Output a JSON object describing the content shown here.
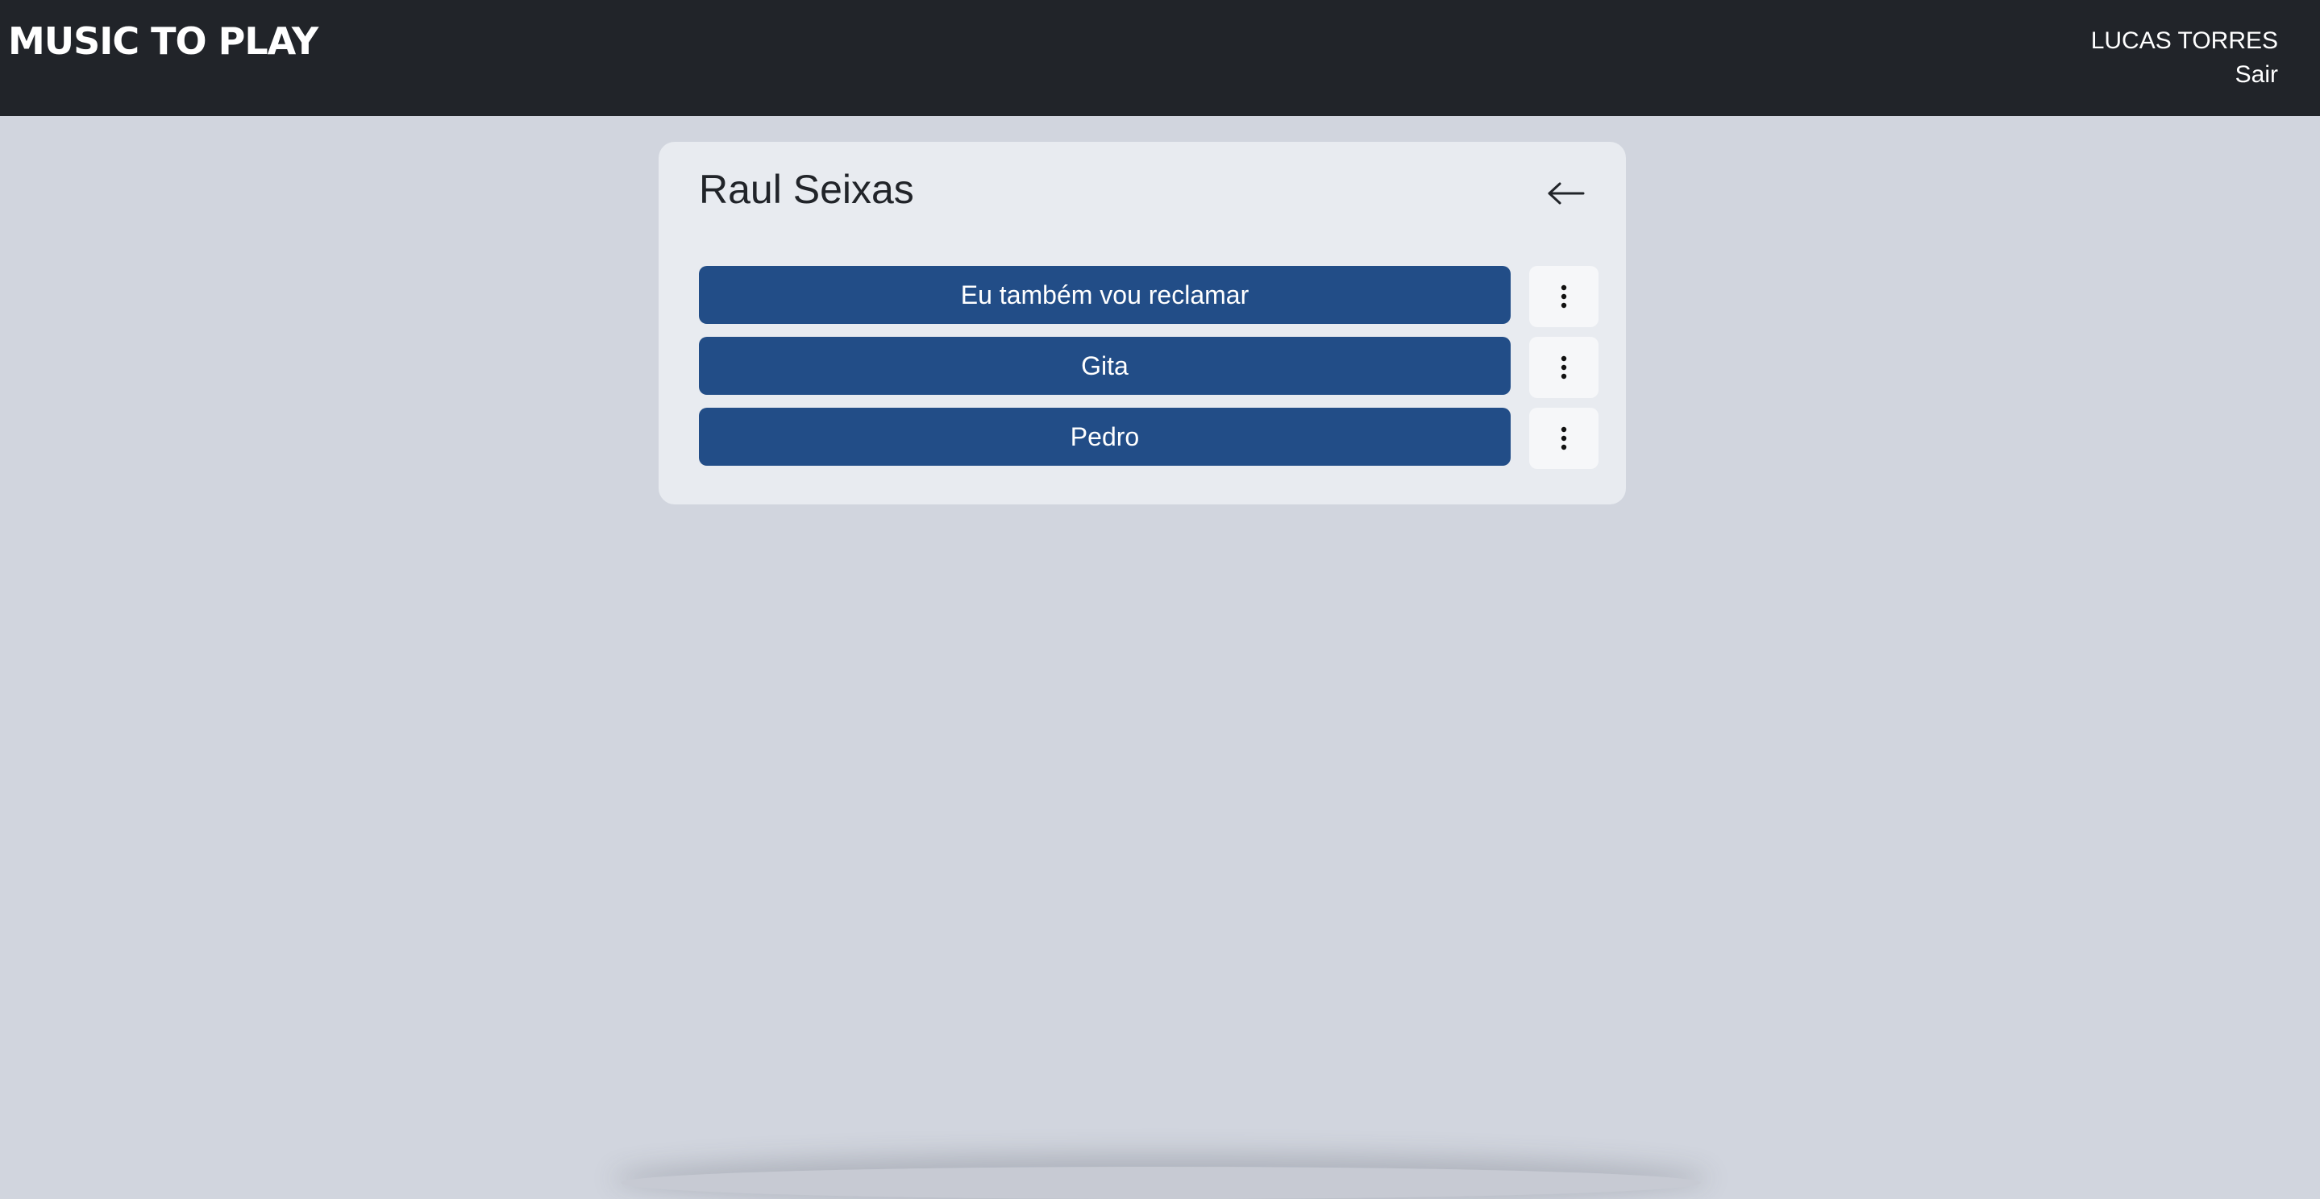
{
  "header": {
    "brand": "MUSIC TO PLAY",
    "user_name": "LUCAS TORRES",
    "logout_label": "Sair"
  },
  "artist": {
    "name": "Raul Seixas",
    "back_icon": "arrow-left-icon",
    "songs": [
      {
        "title": "Eu também vou reclamar",
        "menu_icon": "vertical-dots-icon"
      },
      {
        "title": "Gita",
        "menu_icon": "vertical-dots-icon"
      },
      {
        "title": "Pedro",
        "menu_icon": "vertical-dots-icon"
      }
    ]
  },
  "colors": {
    "header_bg": "#212429",
    "page_bg": "#d1d5de",
    "card_bg": "#e8ebf0",
    "song_button_bg": "#224d87",
    "menu_button_bg": "#f6f7f9"
  }
}
